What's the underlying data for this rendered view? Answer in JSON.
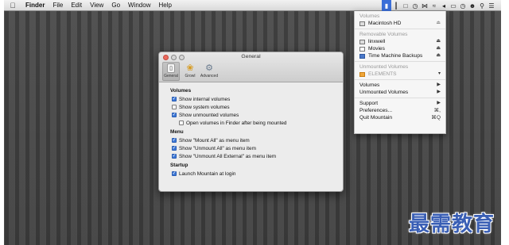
{
  "menubar": {
    "finder": "Finder",
    "file": "File",
    "edit": "Edit",
    "view": "View",
    "go": "Go",
    "window": "Window",
    "help": "Help"
  },
  "dropdown": {
    "volumes_header": "Volumes",
    "macintosh_hd": "Macintosh HD",
    "removable_header": "Removable Volumes",
    "linxwell": "linxwell",
    "movies": "Movies",
    "time_machine": "Time Machine Backups",
    "unmounted_header": "Unmounted Volumes",
    "elements": "ELEMENTS",
    "volumes_sub": "Volumes",
    "unmount_volumes": "Unmounted Volumes",
    "support": "Support",
    "preferences": "Preferences...",
    "preferences_shortcut": "⌘,",
    "quit": "Quit Mountain",
    "quit_shortcut": "⌘Q"
  },
  "prefs": {
    "title": "General",
    "toolbar": {
      "general": "General",
      "growl": "Growl",
      "advanced": "Advanced"
    },
    "volumes_section": "Volumes",
    "show_internal": "Show internal volumes",
    "show_internal_checked": true,
    "show_system": "Show system volumes",
    "show_system_checked": false,
    "show_unmounted": "Show unmounted volumes",
    "show_unmounted_checked": true,
    "open_in_finder": "Open volumes in Finder after being mounted",
    "open_in_finder_checked": false,
    "menu_section": "Menu",
    "mount_all": "Show \"Mount All\" as menu item",
    "mount_all_checked": true,
    "unmount_all": "Show \"Unmount All\" as menu item",
    "unmount_all_checked": true,
    "unmount_all_external": "Show \"Unmount All External\" as menu item",
    "unmount_all_external_checked": true,
    "startup_section": "Startup",
    "launch_at_login": "Launch Mountain at login",
    "launch_at_login_checked": true
  },
  "watermark": "最需教育",
  "colors": {
    "checkbox_on": "#3d78d7",
    "active_status": "#3b6fd8",
    "watermark": "#3a5fb5"
  }
}
